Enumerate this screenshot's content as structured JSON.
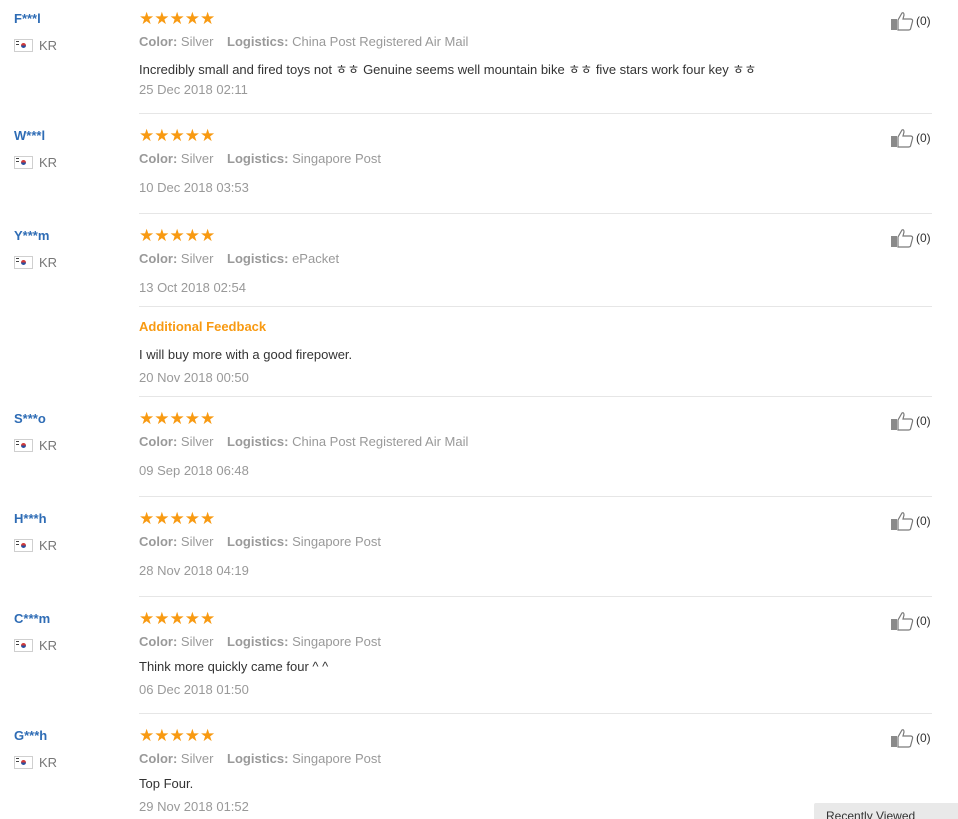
{
  "labels": {
    "color": "Color:",
    "logistics": "Logistics:",
    "additional_feedback": "Additional Feedback"
  },
  "stars": "★★★★★",
  "reviews": [
    {
      "user": "F***l",
      "country": "KR",
      "color": "Silver",
      "logistics": "China Post Registered Air Mail",
      "text": "Incredibly small and fired toys not ㅎㅎ Genuine seems well mountain bike ㅎㅎ five stars work four key ㅎㅎ",
      "date": "25 Dec 2018 02:11",
      "helpful": "(0)"
    },
    {
      "user": "W***l",
      "country": "KR",
      "color": "Silver",
      "logistics": "Singapore Post",
      "date": "10 Dec 2018 03:53",
      "helpful": "(0)"
    },
    {
      "user": "Y***m",
      "country": "KR",
      "color": "Silver",
      "logistics": "ePacket",
      "date": "13 Oct 2018 02:54",
      "helpful": "(0)",
      "additional_text": "I will buy more with a good firepower.",
      "additional_date": "20 Nov 2018 00:50"
    },
    {
      "user": "S***o",
      "country": "KR",
      "color": "Silver",
      "logistics": "China Post Registered Air Mail",
      "date": "09 Sep 2018 06:48",
      "helpful": "(0)"
    },
    {
      "user": "H***h",
      "country": "KR",
      "color": "Silver",
      "logistics": "Singapore Post",
      "date": "28 Nov 2018 04:19",
      "helpful": "(0)"
    },
    {
      "user": "C***m",
      "country": "KR",
      "color": "Silver",
      "logistics": "Singapore Post",
      "text": "Think more quickly came four ^ ^",
      "date": "06 Dec 2018 01:50",
      "helpful": "(0)"
    },
    {
      "user": "G***h",
      "country": "KR",
      "color": "Silver",
      "logistics": "Singapore Post",
      "text": "Top Four.",
      "date": "29 Nov 2018 01:52",
      "helpful": "(0)"
    }
  ],
  "recently_viewed": "Recently Viewed",
  "colors": {
    "accent": "#f89a12",
    "user_link": "#2e6cb5",
    "muted": "#999999"
  }
}
